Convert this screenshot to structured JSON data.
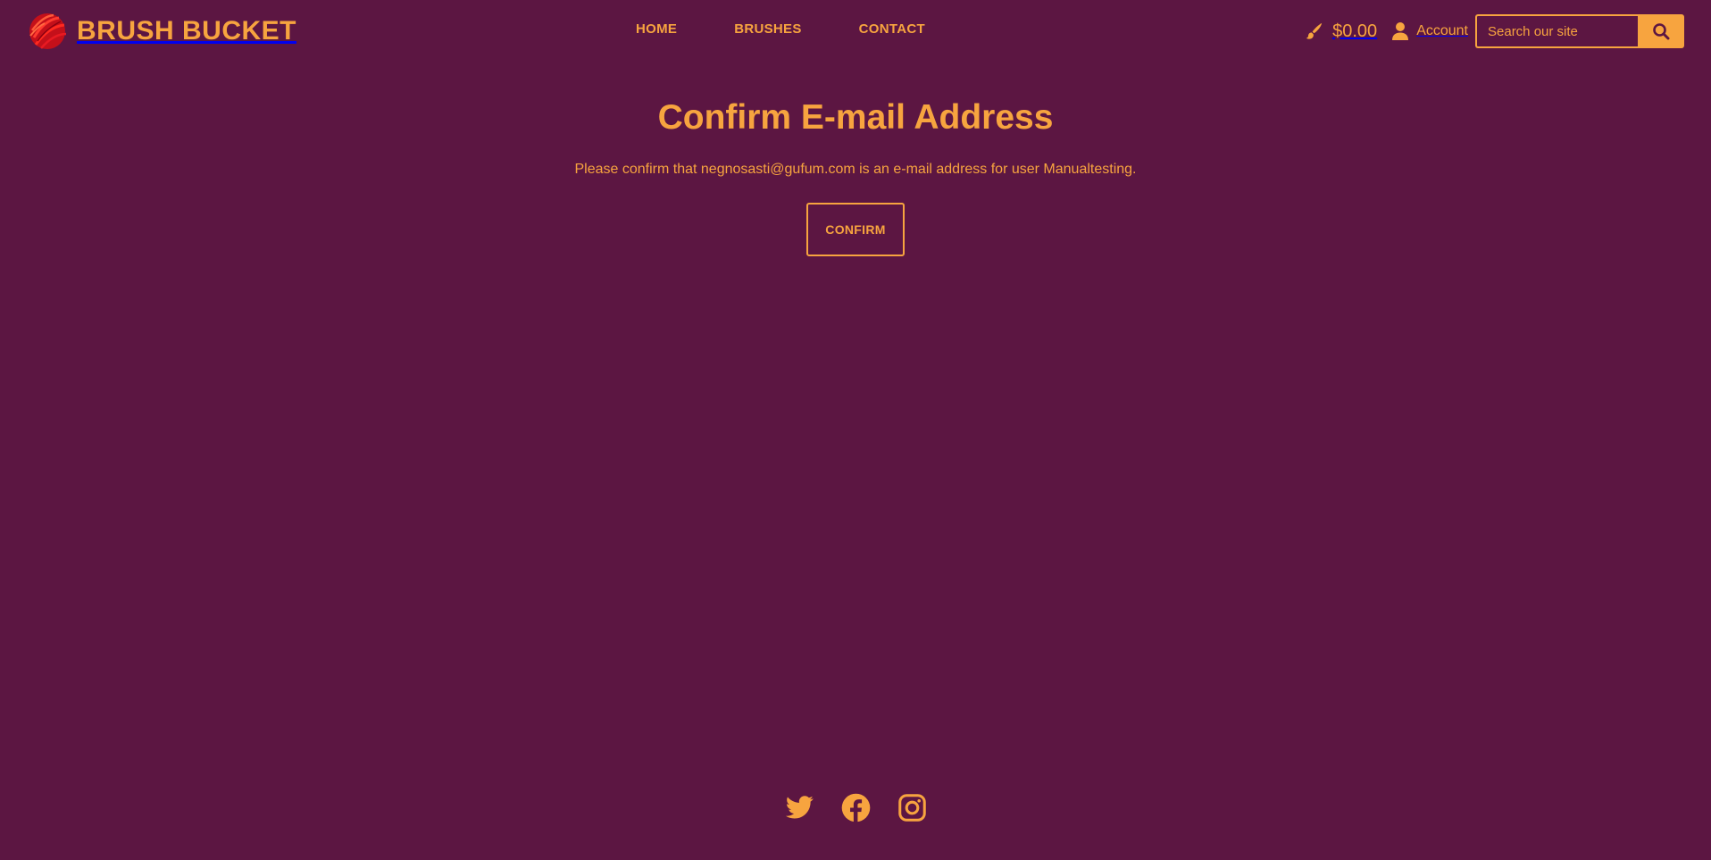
{
  "brand": {
    "name": "BRUSH BUCKET",
    "logo_icon": "paint-splash-logo",
    "colors": {
      "background": "#5c1642",
      "accent": "#f7a43f",
      "logo_red": "#e0141e"
    }
  },
  "nav": {
    "items": [
      {
        "label": "HOME"
      },
      {
        "label": "BRUSHES"
      },
      {
        "label": "CONTACT"
      }
    ]
  },
  "tools": {
    "cart_icon": "paintbrush-icon",
    "cart_total": "$0.00",
    "account_icon": "user-icon",
    "account_label": "Account",
    "search_placeholder": "Search our site",
    "search_icon": "search-icon"
  },
  "main": {
    "title": "Confirm E-mail Address",
    "message": "Please confirm that negnosasti@gufum.com is an e-mail address for user Manualtesting.",
    "confirm_label": "CONFIRM"
  },
  "footer": {
    "social": [
      {
        "name": "twitter-icon"
      },
      {
        "name": "facebook-icon"
      },
      {
        "name": "instagram-icon"
      }
    ]
  }
}
